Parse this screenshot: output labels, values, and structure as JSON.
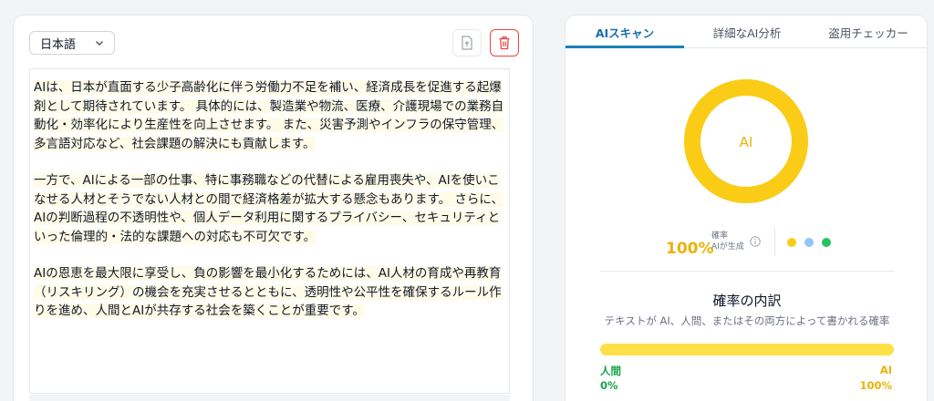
{
  "editor": {
    "language_select": "日本語",
    "paragraphs": [
      "AIは、日本が直面する少子高齢化に伴う労働力不足を補い、経済成長を促進する起爆剤として期待されています。 具体的には、製造業や物流、医療、介護現場での業務自動化・効率化により生産性を向上させます。 また、災害予測やインフラの保守管理、多言語対応など、社会課題の解決にも貢献します。",
      "一方で、AIによる一部の仕事、特に事務職などの代替による雇用喪失や、AIを使いこなせる人材とそうでない人材との間で経済格差が拡大する懸念もあります。 さらに、AIの判断過程の不透明性や、個人データ利用に関するプライバシー、セキュリティといった倫理的・法的な課題への対応も不可欠です。",
      "AIの恩恵を最大限に享受し、負の影響を最小化するためには、AI人材の育成や再教育（リスキリング）の機会を充実させるとともに、透明性や公平性を確保するルール作りを進め、人間とAIが共存する社会を築くことが重要です。"
    ]
  },
  "result": {
    "tabs": [
      {
        "label": "AIスキャン",
        "active": true
      },
      {
        "label": "詳細なAI分析",
        "active": false
      },
      {
        "label": "盗用チェッカー",
        "active": false
      }
    ],
    "donut_label": "AI",
    "donut_ai_fraction": 1.0,
    "probability_value": "100%",
    "probability_label_line1": "確率",
    "probability_label_line2": "AIが生成",
    "legend_dot_colors": [
      "#facc15",
      "#93c5fd",
      "#22c55e"
    ],
    "breakdown_title": "確率の内訳",
    "breakdown_subtitle": "テキストが AI、人間、またはその両方によって書かれる確率",
    "bar_ai_fraction": 1.0,
    "human_label": "人間",
    "human_value": "0%",
    "ai_label": "AI",
    "ai_value": "100%"
  },
  "colors": {
    "accent": "#1a7fb8",
    "ai_yellow": "#facc15",
    "human_green": "#16a34a",
    "danger": "#ef4444"
  }
}
